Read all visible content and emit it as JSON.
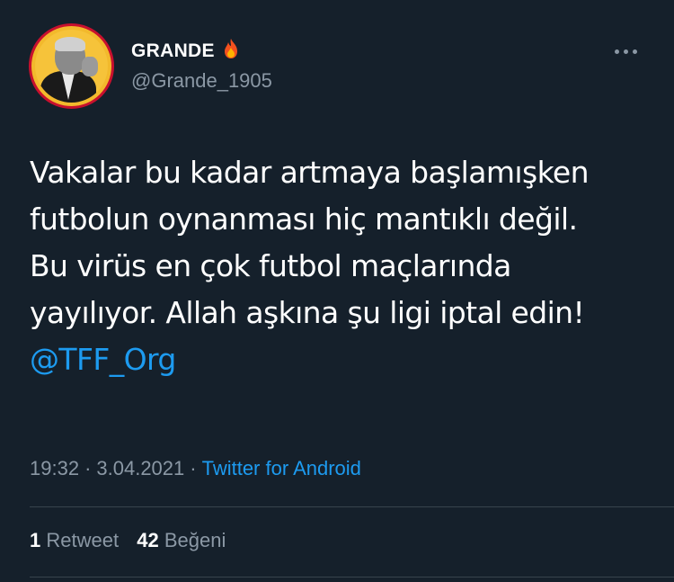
{
  "user": {
    "display_name": "GRANDE",
    "handle": "@Grande_1905",
    "name_emoji": "fire-icon"
  },
  "tweet": {
    "lines": [
      "Vakalar bu kadar artmaya başlamışken",
      "futbolun oynanması hiç mantıklı değil.",
      "Bu virüs en çok futbol maçlarında",
      "yayılıyor. Allah aşkına şu ligi iptal edin!"
    ],
    "mention": "@TFF_Org"
  },
  "meta": {
    "time": "19:32",
    "separator": "·",
    "date": "3.04.2021",
    "source": "Twitter for Android"
  },
  "stats": {
    "retweet_count": "1",
    "retweet_label": "Retweet",
    "like_count": "42",
    "like_label": "Beğeni"
  },
  "colors": {
    "background": "#15202b",
    "text": "#ffffff",
    "secondary": "#8b98a5",
    "accent": "#1d9bf0",
    "divider": "#38444d"
  }
}
